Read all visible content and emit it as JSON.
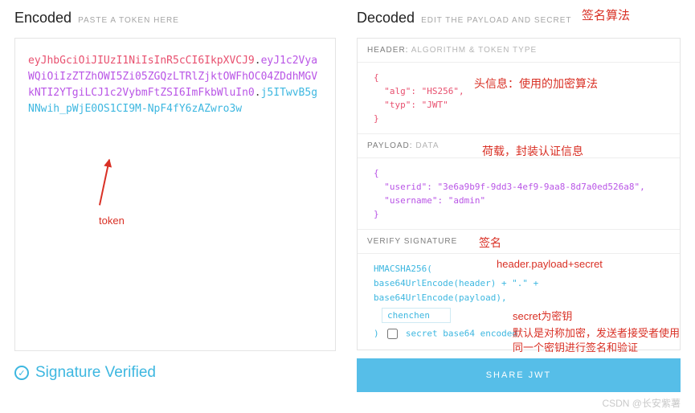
{
  "encoded": {
    "title": "Encoded",
    "subtitle": "PASTE A TOKEN HERE",
    "token_header": "eyJhbGciOiJIUzI1NiIsInR5cCI6IkpXVCJ9",
    "token_payload": "eyJ1c2VyaWQiOiIzZTZhOWI5Zi05ZGQzLTRlZjktOWFhOC04ZDdhMGVkNTI2YTgiLCJ1c2VybmFtZSI6ImFkbWluIn0",
    "token_signature": "j5ITwvB5gNNwih_pWjE0OS1CI9M-NpF4fY6zAZwro3w",
    "dot": "."
  },
  "decoded": {
    "title": "Decoded",
    "subtitle": "EDIT THE PAYLOAD AND SECRET",
    "header_label": "HEADER: ",
    "header_sub": "ALGORITHM & TOKEN TYPE",
    "header_code": "{\n  \"alg\": \"HS256\",\n  \"typ\": \"JWT\"\n}",
    "payload_label": "PAYLOAD: ",
    "payload_sub": "DATA",
    "payload_code": "{\n  \"userid\": \"3e6a9b9f-9dd3-4ef9-9aa8-8d7a0ed526a8\",\n  \"username\": \"admin\"\n}",
    "verify_label": "VERIFY SIGNATURE",
    "sig_line1": "HMACSHA256(",
    "sig_line2": "  base64UrlEncode(header) + \".\" +",
    "sig_line3": "  base64UrlEncode(payload),",
    "sig_close": ") ",
    "secret_value": "chenchen",
    "secret_checkbox_label": "secret base64 encoded"
  },
  "share_button": "SHARE JWT",
  "signature_verified": "Signature Verified",
  "annotations": {
    "sig_algo": "签名算法",
    "header_info": "头信息：使用的加密算法",
    "payload_info": "荷载，封装认证信息",
    "sign": "签名",
    "formula": "header.payload+secret",
    "secret_note": "secret为密钥",
    "default_note": "默认是对称加密，发送者接受者使用同一个密钥进行签名和验证",
    "token_label": "token"
  },
  "watermark": "CSDN @长安紫薯"
}
